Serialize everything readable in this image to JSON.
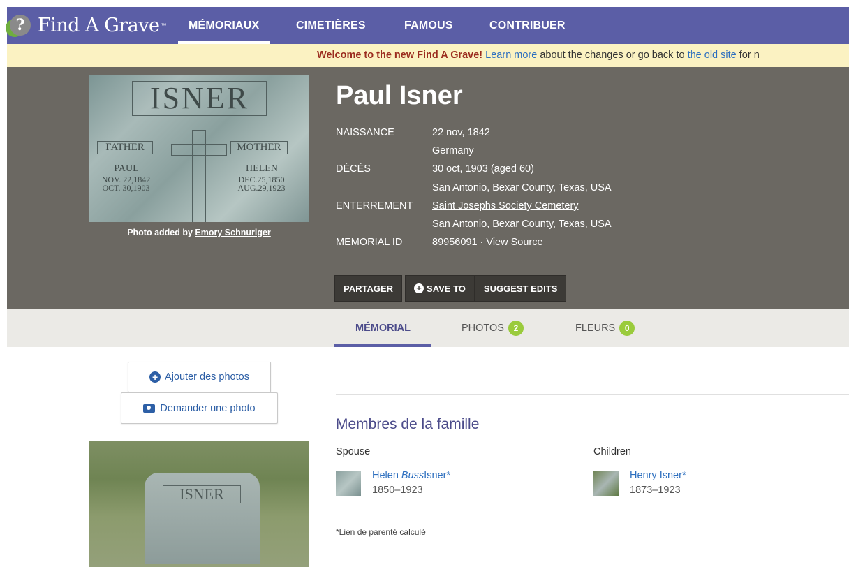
{
  "nav": {
    "logo_text": "Find A Grave",
    "logo_tm": "™",
    "items": [
      "MÉMORIAUX",
      "CIMETIÈRES",
      "FAMOUS",
      "CONTRIBUER"
    ]
  },
  "banner": {
    "welcome": "Welcome to the new Find A Grave!",
    "learn_more": "Learn more",
    "middle": "about the changes or go back to",
    "old_site": "the old site",
    "tail": "for n"
  },
  "photo": {
    "caption_prefix": "Photo added by",
    "contributor": "Emory Schnuriger",
    "stone": {
      "surname": "ISNER",
      "left_label": "FATHER",
      "right_label": "MOTHER",
      "left_name": "PAUL",
      "left_birth": "NOV. 22,1842",
      "left_death": "OCT. 30,1903",
      "right_name": "HELEN",
      "right_birth": "DEC.25,1850",
      "right_death": "AUG.29,1923"
    }
  },
  "memorial": {
    "name": "Paul Isner",
    "birth_label": "NAISSANCE",
    "birth_date": "22 nov, 1842",
    "birth_place": "Germany",
    "death_label": "DÉCÈS",
    "death_date": "30 oct, 1903 (aged 60)",
    "death_place": "San Antonio, Bexar County, Texas, USA",
    "burial_label": "ENTERREMENT",
    "burial_cemetery": "Saint Josephs Society Cemetery",
    "burial_place": "San Antonio, Bexar County, Texas, USA",
    "id_label": "MEMORIAL ID",
    "id_value": "89956091",
    "id_sep": "·",
    "view_source": "View Source"
  },
  "actions": {
    "share": "PARTAGER",
    "save_to": "SAVE TO",
    "suggest": "SUGGEST EDITS"
  },
  "tabs": {
    "memorial": "MÉMORIAL",
    "photos": "PHOTOS",
    "photos_count": "2",
    "flowers": "FLEURS",
    "flowers_count": "0"
  },
  "sidebar": {
    "add_photos": "Ajouter des photos",
    "request_photo": "Demander une photo",
    "photo_surname": "ISNER"
  },
  "family": {
    "title": "Membres de la famille",
    "spouse_heading": "Spouse",
    "spouse_first": "Helen",
    "spouse_maiden": "Buss",
    "spouse_last": "Isner*",
    "spouse_years": "1850–1923",
    "children_heading": "Children",
    "child_name": "Henry Isner*",
    "child_years": "1873–1923",
    "note": "*Lien de parenté calculé"
  },
  "colors": {
    "nav_bg": "#5b5ea6",
    "header_bg": "#6b6862",
    "banner_bg": "#fbf2c2",
    "badge_green": "#9acb3c",
    "link_blue": "#2d6fbf"
  }
}
